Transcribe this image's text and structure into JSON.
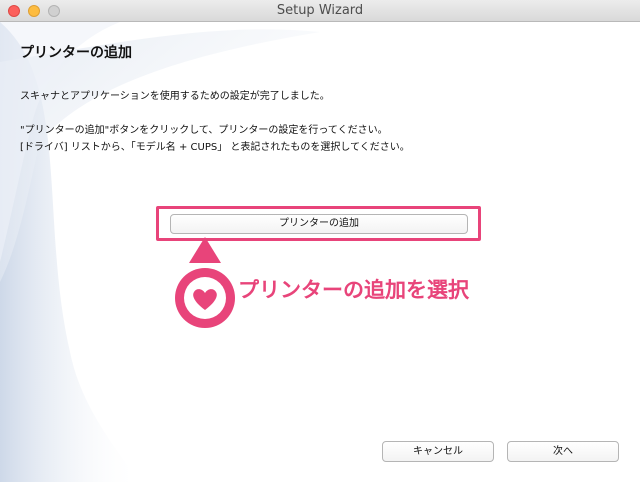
{
  "window": {
    "title": "Setup Wizard"
  },
  "heading": "プリンターの追加",
  "paragraphs": {
    "line1": "スキャナとアプリケーションを使用するための設定が完了しました。",
    "line2": "\"プリンターの追加\"ボタンをクリックして、プリンターの設定を行ってください。",
    "line3": "[ドライバ] リストから、「モデル名 + CUPS」 と表記されたものを選択してください。"
  },
  "buttons": {
    "add_printer": "プリンターの追加",
    "cancel": "キャンセル",
    "next": "次へ"
  },
  "annotation": {
    "text": "プリンターの追加を選択",
    "color": "#e8447a",
    "icon": "heart-icon"
  }
}
